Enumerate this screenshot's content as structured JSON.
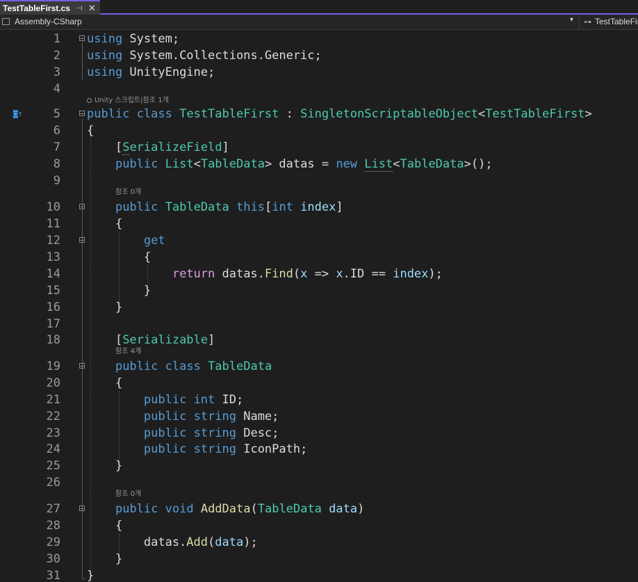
{
  "tab": {
    "title": "TestTableFirst.cs",
    "pin": "⊣",
    "close": "✕"
  },
  "navbar": {
    "project": "Assembly-CSharp",
    "class_scope": "TestTableFirst",
    "dropdown": "▾",
    "class_icon": "⊶"
  },
  "hints": {
    "class": {
      "unity": "Unity 스크립트",
      "sep": "|",
      "refs": "참조 1개"
    },
    "indexer": "참조 0개",
    "tabledata": "참조 4개",
    "adddata": "참조 0개"
  },
  "line_numbers": [
    "1",
    "2",
    "3",
    "4",
    "5",
    "6",
    "7",
    "8",
    "9",
    "10",
    "11",
    "12",
    "13",
    "14",
    "15",
    "16",
    "17",
    "18",
    "19",
    "20",
    "21",
    "22",
    "23",
    "24",
    "25",
    "26",
    "27",
    "28",
    "29",
    "30",
    "31"
  ],
  "code": {
    "l1": [
      "using",
      " System;"
    ],
    "l2": [
      "using",
      " System.Collections.Generic;"
    ],
    "l3": [
      "using",
      " UnityEngine;"
    ],
    "l5": [
      "public",
      " ",
      "class",
      " ",
      "TestTableFirst",
      " : ",
      "SingletonScriptableObject",
      "<",
      "TestTableFirst",
      ">"
    ],
    "l6": [
      "{"
    ],
    "l7": [
      "    [",
      "S",
      "erializeField",
      "]"
    ],
    "l8": [
      "    ",
      "public",
      " ",
      "List",
      "<",
      "TableData",
      "> datas = ",
      "new",
      " ",
      "List",
      "<",
      "TableData",
      ">();"
    ],
    "l10": [
      "    ",
      "public",
      " ",
      "TableData",
      " ",
      "this",
      "[",
      "int",
      " ",
      "index",
      "]"
    ],
    "l11": [
      "    {"
    ],
    "l12": [
      "        ",
      "get"
    ],
    "l13": [
      "        {"
    ],
    "l14": [
      "            ",
      "return",
      " datas.",
      "Find",
      "(",
      "x",
      " => ",
      "x",
      ".ID == ",
      "index",
      ");"
    ],
    "l15": [
      "        }"
    ],
    "l16": [
      "    }"
    ],
    "l18": [
      "    [",
      "Serializable",
      "]"
    ],
    "l19": [
      "    ",
      "public",
      " ",
      "class",
      " ",
      "TableData"
    ],
    "l20": [
      "    {"
    ],
    "l21": [
      "        ",
      "public",
      " ",
      "int",
      " ID;"
    ],
    "l22": [
      "        ",
      "public",
      " ",
      "string",
      " Name;"
    ],
    "l23": [
      "        ",
      "public",
      " ",
      "string",
      " Desc;"
    ],
    "l24": [
      "        ",
      "public",
      " ",
      "string",
      " IconPath;"
    ],
    "l25": [
      "    }"
    ],
    "l27": [
      "    ",
      "public",
      " ",
      "void",
      " ",
      "AddData",
      "(",
      "TableData",
      " ",
      "data",
      ")"
    ],
    "l28": [
      "    {"
    ],
    "l29": [
      "        datas.",
      "Add",
      "(",
      "data",
      ");"
    ],
    "l30": [
      "    }"
    ],
    "l31": [
      "}"
    ]
  },
  "gutter_marker": "◙↑",
  "colors": {
    "keyword": "#569cd6",
    "type": "#4ec9b0",
    "param": "#9cdcfe",
    "method": "#dcdcaa",
    "control": "#d8a0df",
    "text": "#dcdcdc",
    "accent": "#7160e8"
  }
}
